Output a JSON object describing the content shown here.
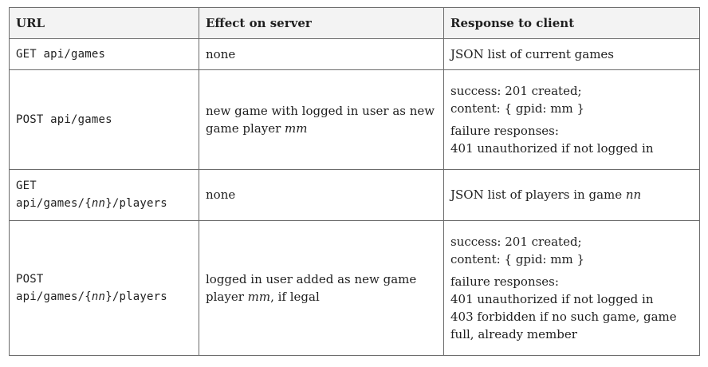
{
  "headers": [
    "URL",
    "Effect on server",
    "Response to client"
  ],
  "rows": [
    {
      "url": "GET api/games",
      "effect": "none",
      "response": "JSON list of current games"
    },
    {
      "url": "POST api/games",
      "effect_pre": "new game with logged in user as new game player ",
      "effect_var": "mm",
      "success_1": "success: 201 created;",
      "success_2": "content: { gpid: mm }",
      "failure_1": "failure responses:",
      "failure_2": "401 unauthorized if not logged in"
    },
    {
      "url_line1": "GET",
      "url_pre": "api/games/{",
      "url_var": "nn",
      "url_post": "}/players",
      "effect": "none",
      "response_pre": "JSON list of players in game ",
      "response_var": "nn"
    },
    {
      "url_line1": "POST",
      "url_pre": "api/games/{",
      "url_var": "nn",
      "url_post": "}/players",
      "effect_pre": "logged in user added as new game player ",
      "effect_var": "mm",
      "effect_post": ", if legal",
      "success_1": "success: 201 created;",
      "success_2": "content: { gpid: mm }",
      "failure_1": "failure responses:",
      "failure_2": "401 unauthorized if not logged in",
      "failure_3": "403 forbidden if no such game, game full, already member"
    }
  ]
}
